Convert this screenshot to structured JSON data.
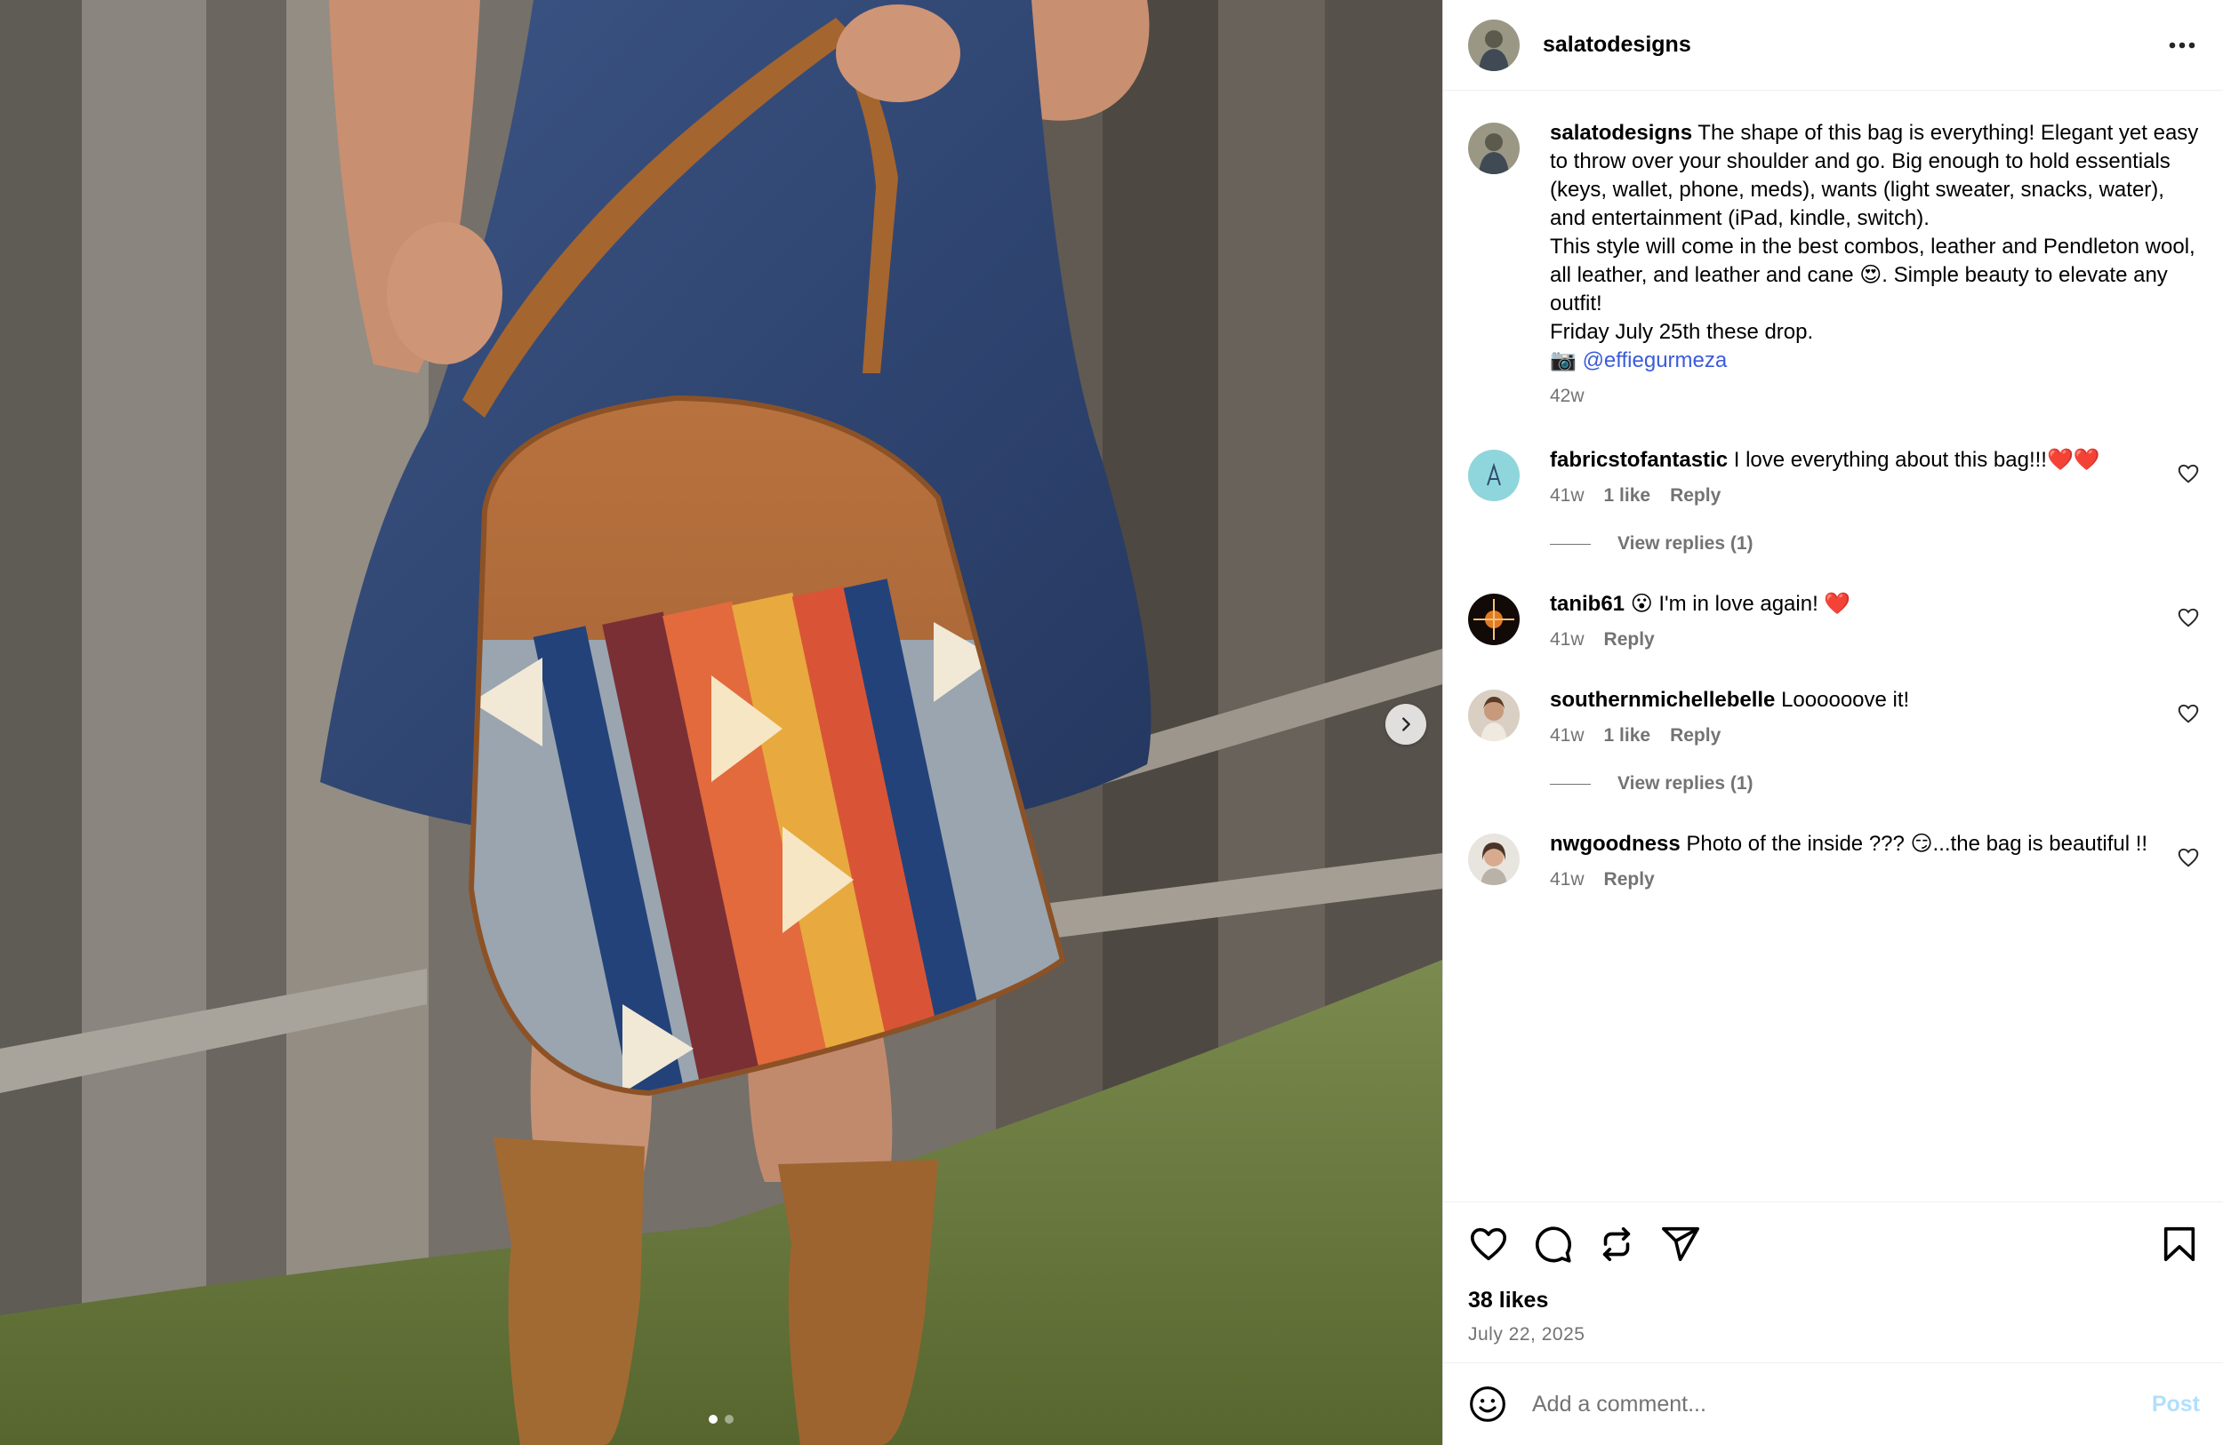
{
  "post": {
    "username": "salatodesigns",
    "more_icon": "more-horizontal-icon",
    "next_icon": "chevron-right-icon",
    "carousel": {
      "count": 2,
      "active": 0
    }
  },
  "caption": {
    "username": "salatodesigns",
    "text": "The shape of this bag is everything! Elegant yet easy to throw over your shoulder and go. Big enough to hold essentials (keys, wallet, phone, meds), wants (light sweater, snacks, water), and entertainment (iPad, kindle, switch).\nThis style will come in the best combos, leather and Pendleton wool, all leather, and leather and cane 😍. Simple beauty to elevate any outfit!\nFriday July 25th these drop.\n📷 ",
    "mention": "@effiegurmeza",
    "time": "42w"
  },
  "comments": [
    {
      "username": "fabricstofantastic",
      "text": "I love everything about this bag!!!❤️❤️",
      "time": "41w",
      "likes": "1 like",
      "reply": "Reply",
      "view_replies": "View replies (1)"
    },
    {
      "username": "tanib61",
      "text": "😮 I'm in love again! ❤️",
      "time": "41w",
      "reply": "Reply"
    },
    {
      "username": "southernmichellebelle",
      "text": "Loooooove it!",
      "time": "41w",
      "likes": "1 like",
      "reply": "Reply",
      "view_replies": "View replies (1)"
    },
    {
      "username": "nwgoodness",
      "text": "Photo of the inside ??? 😏...the bag is beautiful !!",
      "time": "41w",
      "reply": "Reply"
    }
  ],
  "actions": {
    "likes": "38 likes",
    "date": "July 22, 2025",
    "icons": [
      "heart-icon",
      "comment-icon",
      "repost-icon",
      "share-icon",
      "bookmark-icon"
    ]
  },
  "add_comment": {
    "placeholder": "Add a comment...",
    "post_label": "Post"
  },
  "colors": {
    "link": "#3b5bdb",
    "post_disabled": "#b2dffc",
    "secondary_text": "#737373"
  }
}
